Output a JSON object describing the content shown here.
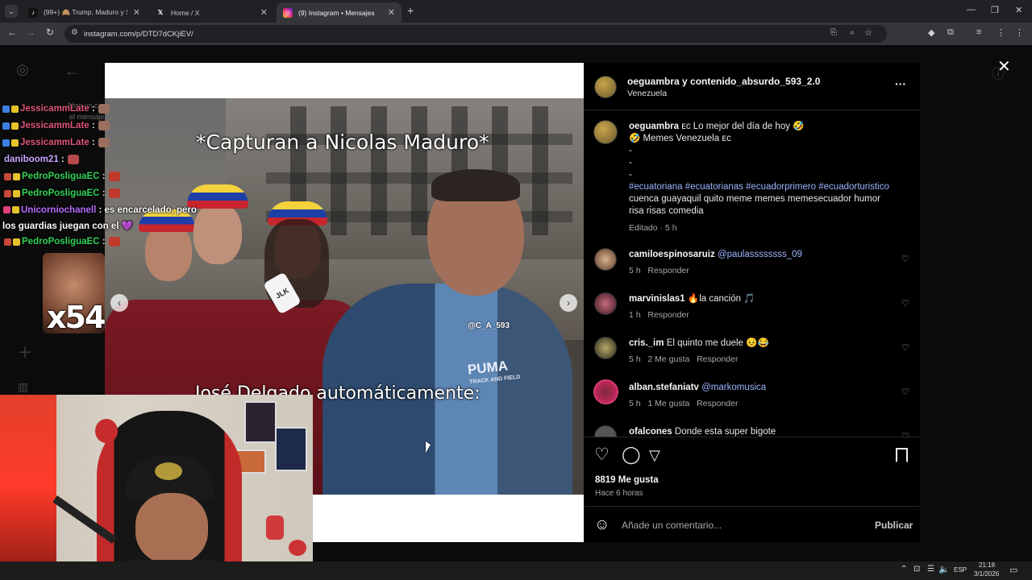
{
  "browser": {
    "tabs": [
      {
        "title": "(99+) 🙈 Trump, Maduro y Sán",
        "icon": "tiktok-icon"
      },
      {
        "title": "Home / X",
        "icon": "x-icon"
      },
      {
        "title": "(9) Instagram • Mensajes",
        "icon": "instagram-icon",
        "active": true
      }
    ],
    "url": "instagram.com/p/DTD7dCKjiEV/"
  },
  "post": {
    "author": "oeguambra y contenido_absurdo_593_2.0",
    "location": "Venezuela",
    "caption_user": "oeguambra",
    "caption_line1": "ᴇᴄ Lo mejor del día de hoy 🤣",
    "caption_line2": "🤣 Memes Venezuela ᴇᴄ",
    "dash1": "-",
    "dash2": "-",
    "dash3": "-",
    "hashtags": "#ecuatoriana #ecuatorianas #ecuadorprimero #ecuadorturistico",
    "tags_plain_1": "cuenca guayaquil quito meme memes memesecuador humor",
    "tags_plain_2": "risa risas comedia",
    "edited": "Editado · 5 h",
    "likes": "8819 Me gusta",
    "time_ago": "Hace 6 horas",
    "comment_placeholder": "Añade un comentario...",
    "publish": "Publicar"
  },
  "media": {
    "top_caption": "*Capturan a Nicolas Maduro*",
    "bottom_caption": "José Delgado automáticamente:",
    "watermark": "@C_A_593",
    "mic_label": "JLK",
    "shirt_text": "PUMA",
    "shirt_sub": "TRACK AND FIELD"
  },
  "comments": [
    {
      "user": "camiloespinosaruiz",
      "mention": "@paulassssssss_09",
      "text": "",
      "time": "5 h",
      "likes": "",
      "reply": "Responder"
    },
    {
      "user": "marvinislas1",
      "mention": "",
      "text": "🔥la canción 🎵",
      "time": "1 h",
      "likes": "",
      "reply": "Responder"
    },
    {
      "user": "cris._im",
      "mention": "",
      "text": "El quinto me duele 😣😂",
      "time": "5 h",
      "likes": "2 Me gusta",
      "reply": "Responder"
    },
    {
      "user": "alban.stefaniatv",
      "mention": "@markomusica",
      "text": "",
      "time": "5 h",
      "likes": "1 Me gusta",
      "reply": "Responder"
    },
    {
      "user": "ofalcones",
      "mention": "",
      "text": "Donde esta super bigote",
      "time": "",
      "likes": "",
      "reply": ""
    }
  ],
  "chat": [
    {
      "user": "JessicammLate",
      "text": " :",
      "color": "#e0567a"
    },
    {
      "user": "JessicammLate",
      "text": " :",
      "color": "#e0567a"
    },
    {
      "user": "JessicammLate",
      "text": " :",
      "color": "#e0567a"
    },
    {
      "user": "daniboom21",
      "text": " :",
      "color": "#c7a6ff"
    },
    {
      "user": "PedroPosliguaEC",
      "text": " :",
      "color": "#33d35a"
    },
    {
      "user": "PedroPosliguaEC",
      "text": " :",
      "color": "#33d35a"
    },
    {
      "user": "Unicorniochanell",
      "text": " : es encarcelado, pero",
      "color": "#b86bff"
    },
    {
      "user": "",
      "text": "los guardias juegan con el 💜",
      "color": "#ffffff"
    },
    {
      "user": "PedroPosliguaEC",
      "text": " :",
      "color": "#33d35a"
    }
  ],
  "overlay": {
    "multiplier": "x54",
    "ghost_text": "Abre un c",
    "ghost_text2": "el mensaje"
  },
  "taskbar": {
    "lang": "ESP",
    "time": "21:18",
    "date": "3/1/2026"
  },
  "colors": {
    "link": "#9db3ff",
    "panel_bg": "#000000"
  }
}
